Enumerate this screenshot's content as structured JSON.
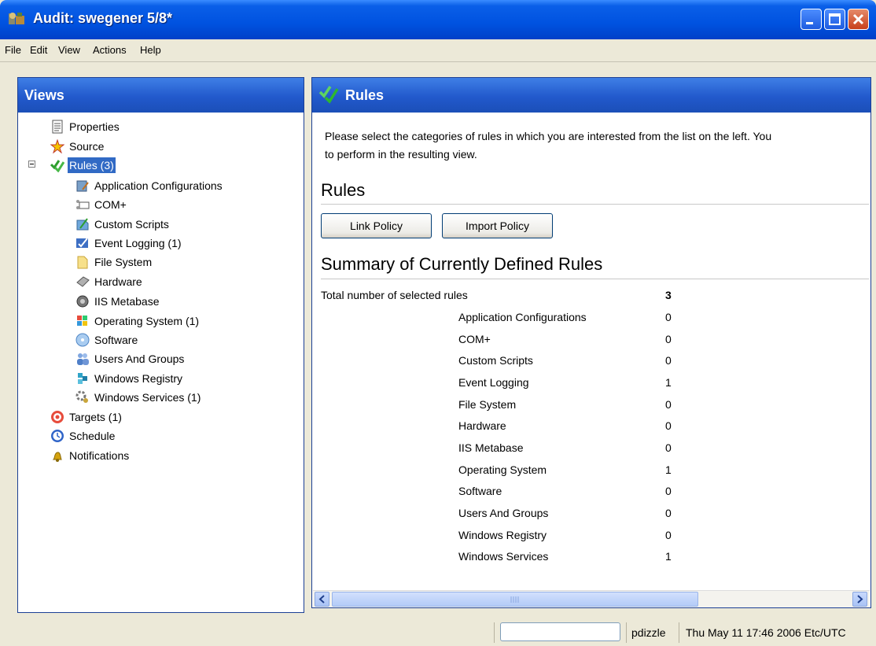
{
  "window": {
    "title": "Audit: swegener 5/8*",
    "controls": [
      "minimize-icon",
      "maximize-icon",
      "close-icon"
    ]
  },
  "menubar": {
    "items": [
      "File",
      "Edit",
      "View",
      "Actions",
      "Help"
    ]
  },
  "views_panel": {
    "title": "Views",
    "tree": [
      {
        "label": "Properties",
        "icon": "properties-icon"
      },
      {
        "label": "Source",
        "icon": "star-icon"
      },
      {
        "label": "Rules (3)",
        "icon": "rules-checkmark-icon",
        "selected": true,
        "expanded": true
      },
      {
        "label": "Application Configurations",
        "icon": "app-config-icon"
      },
      {
        "label": "COM+",
        "icon": "com-icon"
      },
      {
        "label": "Custom Scripts",
        "icon": "script-icon"
      },
      {
        "label": "Event Logging (1)",
        "icon": "event-log-icon"
      },
      {
        "label": "File System",
        "icon": "folder-icon"
      },
      {
        "label": "Hardware",
        "icon": "hardware-icon"
      },
      {
        "label": "IIS Metabase",
        "icon": "iis-icon"
      },
      {
        "label": "Operating System (1)",
        "icon": "os-icon"
      },
      {
        "label": "Software",
        "icon": "software-cd-icon"
      },
      {
        "label": "Users And Groups",
        "icon": "users-icon"
      },
      {
        "label": "Windows Registry",
        "icon": "registry-icon"
      },
      {
        "label": "Windows Services (1)",
        "icon": "services-gear-icon"
      },
      {
        "label": "Targets (1)",
        "icon": "target-icon"
      },
      {
        "label": "Schedule",
        "icon": "clock-icon"
      },
      {
        "label": "Notifications",
        "icon": "bell-icon"
      }
    ]
  },
  "rules_panel": {
    "title": "Rules",
    "intro_line1": "Please select the categories of rules in which you are interested from the list on the left. You",
    "intro_line2": "to perform in the resulting view.",
    "section_heading": "Rules",
    "buttons": {
      "link_policy": "Link Policy",
      "import_policy": "Import Policy"
    },
    "summary_heading": "Summary of Currently Defined Rules",
    "total_label": "Total number of selected rules",
    "total_value": "3",
    "rows": [
      {
        "category": "Application Configurations",
        "count": "0"
      },
      {
        "category": "COM+",
        "count": "0"
      },
      {
        "category": "Custom Scripts",
        "count": "0"
      },
      {
        "category": "Event Logging",
        "count": "1"
      },
      {
        "category": "File System",
        "count": "0"
      },
      {
        "category": "Hardware",
        "count": "0"
      },
      {
        "category": "IIS Metabase",
        "count": "0"
      },
      {
        "category": "Operating System",
        "count": "1"
      },
      {
        "category": "Software",
        "count": "0"
      },
      {
        "category": "Users And Groups",
        "count": "0"
      },
      {
        "category": "Windows Registry",
        "count": "0"
      },
      {
        "category": "Windows Services",
        "count": "1"
      }
    ]
  },
  "statusbar": {
    "user": "pdizzle",
    "datetime": "Thu May 11 17:46 2006 Etc/UTC"
  },
  "colors": {
    "titlebar": "#0052E0",
    "panel_header": "#2259CC",
    "selection": "#316AC5",
    "chrome": "#ECE9D8"
  }
}
